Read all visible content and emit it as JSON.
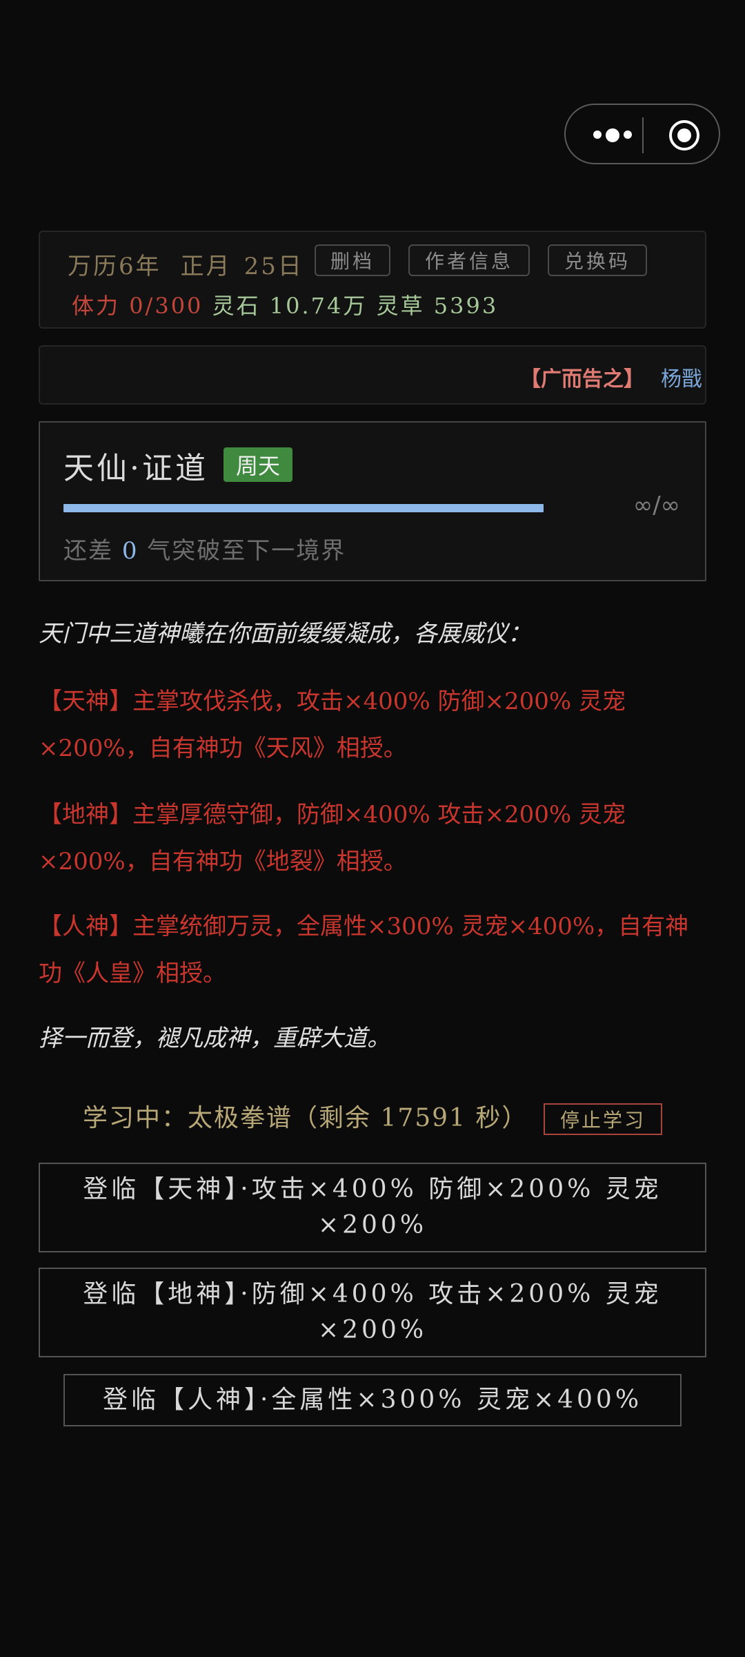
{
  "status": {
    "date_era": "万历6年",
    "date_month": "正月",
    "date_day": "25日",
    "buttons": [
      "删档",
      "作者信息",
      "兑换码"
    ],
    "stamina_label": "体力",
    "stamina_value": "0/300",
    "stone_label": "灵石",
    "stone_value": "10.74万",
    "herb_label": "灵草",
    "herb_value": "5393"
  },
  "ad": {
    "tag": "【广而告之】",
    "name": "杨戬"
  },
  "realm": {
    "title": "天仙·证道",
    "badge": "周天",
    "progress_fraction": 1.0,
    "progress_text": "∞/∞",
    "hint_prefix": "还差 ",
    "hint_value": "0",
    "hint_suffix": " 气突破至下一境界"
  },
  "story": {
    "intro": "天门中三道神曦在你面前缓缓凝成，各展威仪：",
    "god_heaven": "【天神】主掌攻伐杀伐，攻击×400% 防御×200% 灵宠×200%，自有神功《天风》相授。",
    "god_earth": "【地神】主掌厚德守御，防御×400% 攻击×200% 灵宠×200%，自有神功《地裂》相授。",
    "god_human": "【人神】主掌统御万灵，全属性×300% 灵宠×400%，自有神功《人皇》相授。",
    "outro": "择一而登，褪凡成神，重辟大道。"
  },
  "study": {
    "text": "学习中：太极拳谱（剩余 17591 秒）",
    "stop_label": "停止学习"
  },
  "choices": [
    "登临【天神】·攻击×400% 防御×200% 灵宠×200%",
    "登临【地神】·防御×400% 攻击×200% 灵宠×200%",
    "登临【人神】·全属性×300% 灵宠×400%"
  ],
  "colors": {
    "accent_red": "#c8362d",
    "progress_blue": "#8fb8ea",
    "badge_green": "#3f8a3f",
    "resource_green": "#a7c99a",
    "gold_text": "#b8a877"
  }
}
